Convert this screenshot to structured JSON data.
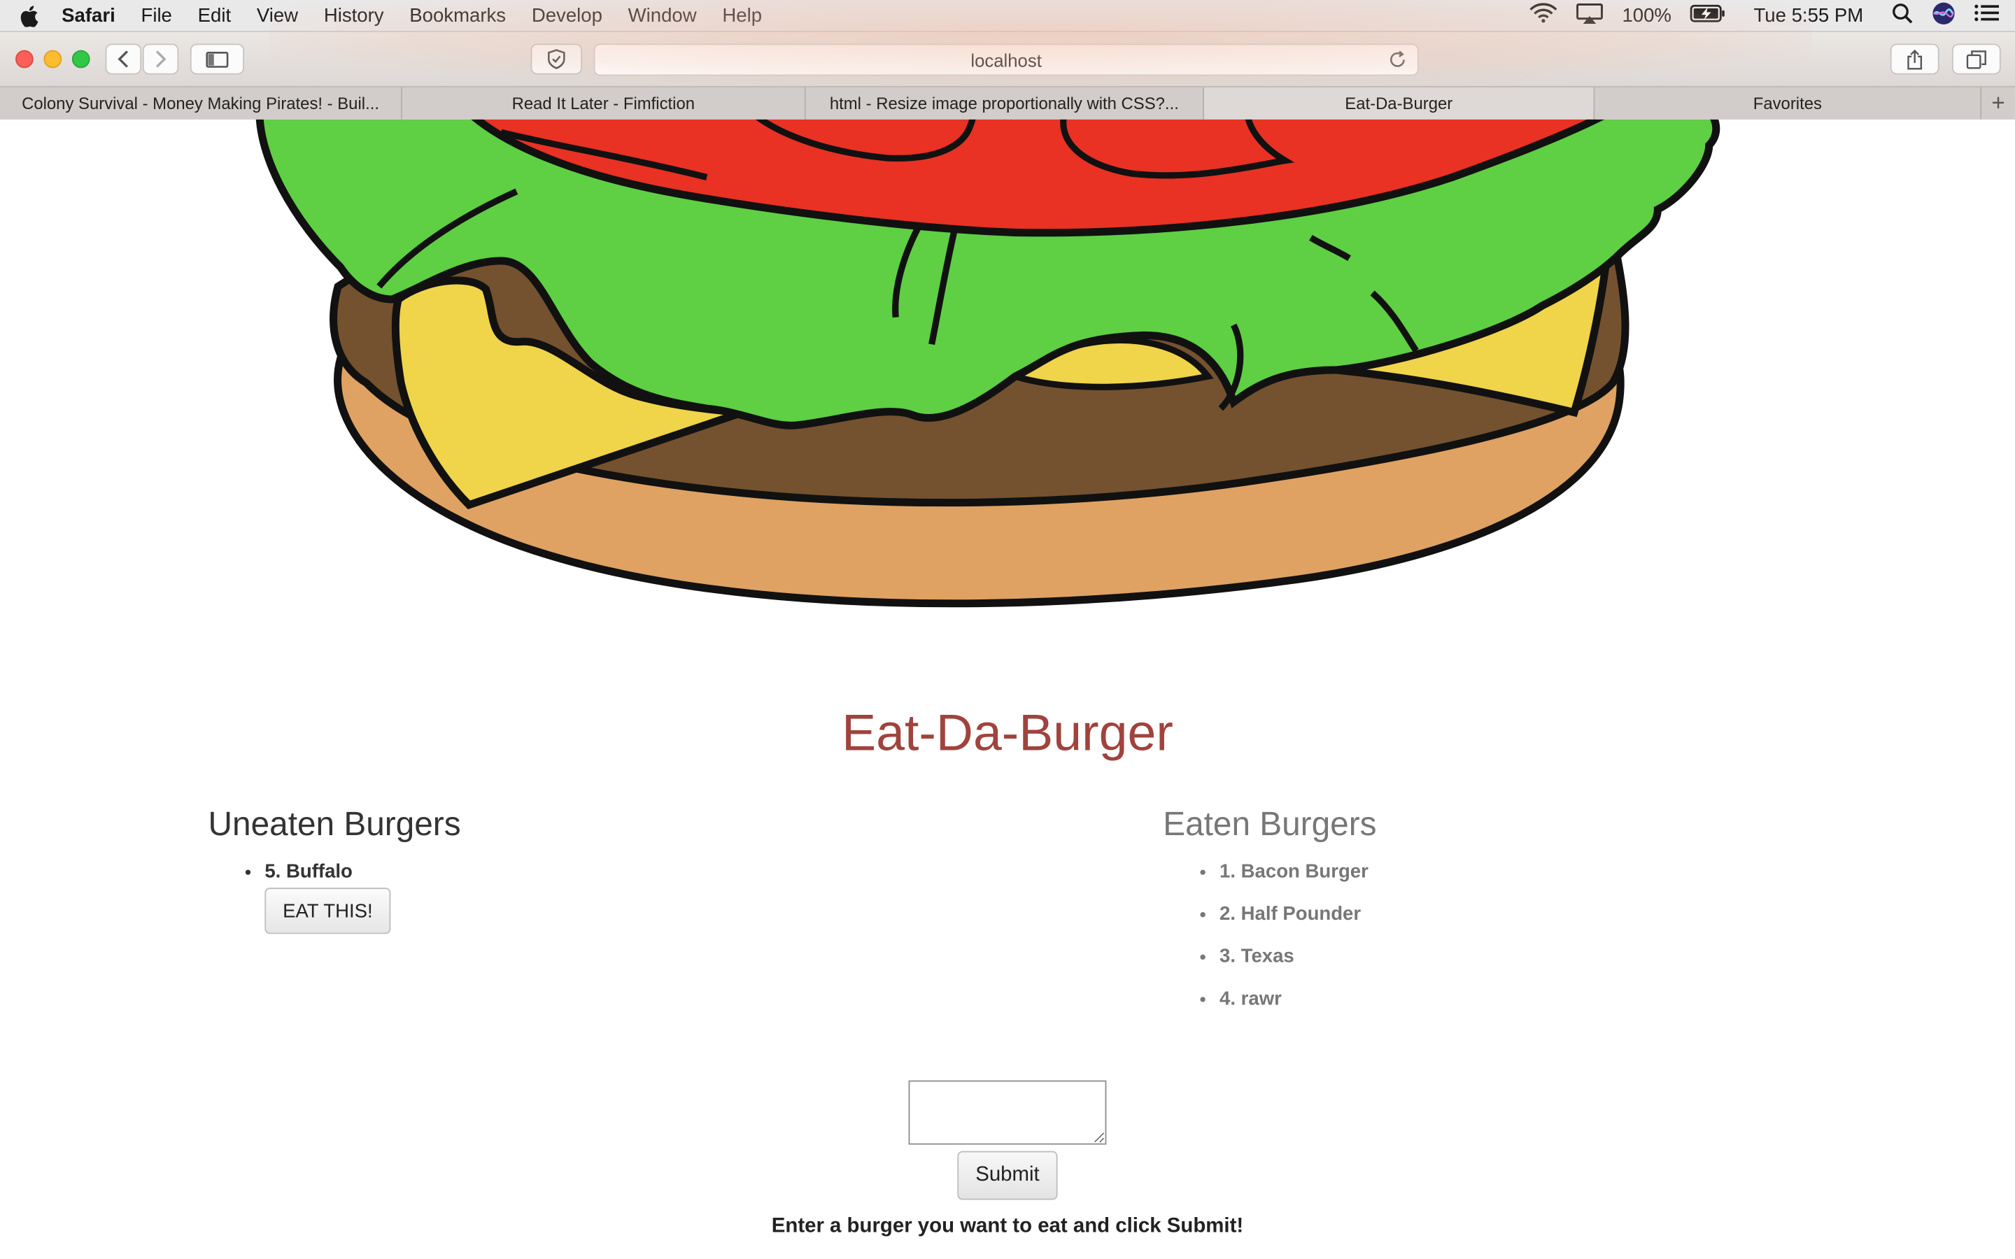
{
  "menubar": {
    "app_name": "Safari",
    "items": [
      "File",
      "Edit",
      "View",
      "History",
      "Bookmarks",
      "Develop",
      "Window",
      "Help"
    ],
    "battery": "100%",
    "clock": "Tue 5:55 PM"
  },
  "browser": {
    "url": "localhost",
    "tabs": [
      {
        "label": "Colony Survival - Money Making Pirates! - Buil...",
        "active": false
      },
      {
        "label": "Read It Later - Fimfiction",
        "active": false
      },
      {
        "label": "html - Resize image proportionally with CSS?...",
        "active": false
      },
      {
        "label": "Eat-Da-Burger",
        "active": true
      },
      {
        "label": "Favorites",
        "active": false
      }
    ],
    "new_tab_label": "+"
  },
  "page": {
    "title": "Eat-Da-Burger",
    "uneaten": {
      "heading": "Uneaten Burgers",
      "items": [
        {
          "label": "5. Buffalo",
          "button": "EAT THIS!"
        }
      ]
    },
    "eaten": {
      "heading": "Eaten Burgers",
      "items": [
        "1. Bacon Burger",
        "2. Half Pounder",
        "3. Texas",
        "4. rawr"
      ]
    },
    "form": {
      "input_value": "",
      "submit_label": "Submit",
      "hint": "Enter a burger you want to eat and click Submit!"
    }
  },
  "colors": {
    "title": "#a0433d",
    "uneaten_text": "#333333",
    "eaten_text": "#777777",
    "lettuce": "#5fcf43",
    "tomato": "#e93124",
    "cheese": "#f0d44a",
    "patty": "#74522f",
    "bun": "#dfa262"
  }
}
